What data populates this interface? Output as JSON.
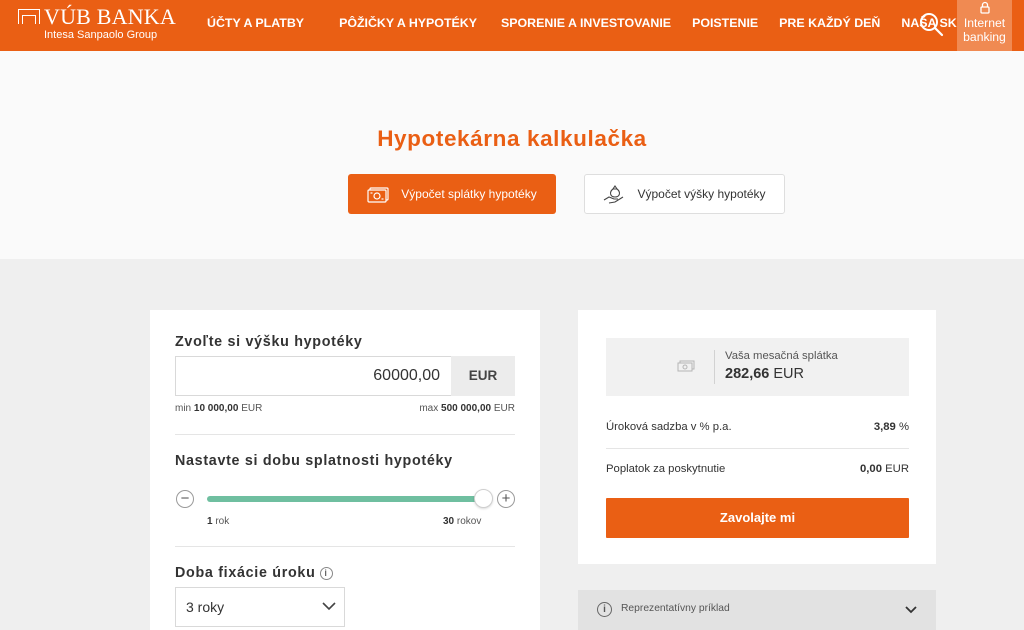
{
  "header": {
    "logo_name": "VÚB BANKA",
    "logo_sub": "Intesa Sanpaolo Group",
    "nav": [
      {
        "label": "ÚČTY A PLATBY"
      },
      {
        "label": "PÔŽIČKY A HYPOTÉKY"
      },
      {
        "label": "SPORENIE A INVESTOVANIE"
      },
      {
        "label": "POISTENIE"
      },
      {
        "label": "PRE KAŽDÝ DEŇ"
      },
      {
        "label": "NAŠA SKUPINA"
      }
    ],
    "internet_banking_l1": "Internet",
    "internet_banking_l2": "banking"
  },
  "hero": {
    "title": "Hypotekárna kalkulačka",
    "tab_active": "Výpočet splátky hypotéky",
    "tab_inactive": "Výpočet výšky hypotéky"
  },
  "calculator": {
    "amount_label": "Zvoľte si výšku hypotéky",
    "amount_value": "60000,00",
    "currency": "EUR",
    "min_prefix": "min",
    "min_value": "10 000,00",
    "min_unit": "EUR",
    "max_prefix": "max",
    "max_value": "500 000,00",
    "max_unit": "EUR",
    "term_label": "Nastavte si dobu splatnosti hypotéky",
    "term_minus": "−",
    "term_plus": "+",
    "term_fraction": 1.0,
    "term_min_num": "1",
    "term_min_unit": "rok",
    "term_max_num": "30",
    "term_max_unit": "rokov",
    "fix_label": "Doba fixácie úroku",
    "fix_info": "i",
    "fix_value": "3 roky"
  },
  "result": {
    "monthly_label": "Vaša mesačná splátka",
    "monthly_value": "282,66",
    "monthly_unit": "EUR",
    "rate_label": "Úroková sadzba v % p.a.",
    "rate_value": "3,89",
    "rate_unit": "%",
    "fee_label": "Poplatok za poskytnutie",
    "fee_value": "0,00",
    "fee_unit": "EUR",
    "call_button": "Zavolajte mi",
    "rep_info": "i",
    "rep_label": "Reprezentatívny príklad"
  },
  "colors": {
    "brand": "#ea5f14",
    "slider": "#6fbfa0"
  }
}
